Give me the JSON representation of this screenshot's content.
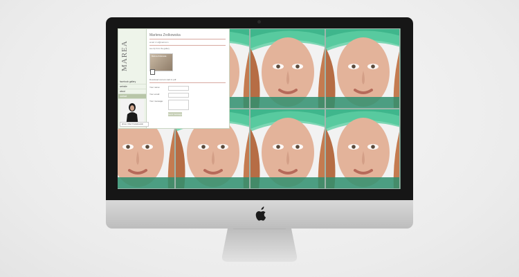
{
  "site": {
    "logo": "MAREA",
    "name": "Marlena Zrolkowska",
    "email_label": "email: zr.ol@mail.com",
    "sublabel": "see zip from the gallery",
    "photo_caption": "Marlena Zrolkowska",
    "download": "Download current card in pdf",
    "nav": [
      "facebook gallery",
      "website",
      "about",
      "contact"
    ],
    "form": {
      "name_label": "Your name:",
      "email_label": "Your email:",
      "message_label": "Your message:",
      "send_label": "Send message"
    },
    "footer": "photo: Marc Kwiatkowski"
  },
  "colors": {
    "green_accent": "#b8c6a8",
    "hat_green": "#3fb68c",
    "bezel": "#161616"
  },
  "icons": [
    "apple-logo-icon",
    "pdf-icon"
  ]
}
